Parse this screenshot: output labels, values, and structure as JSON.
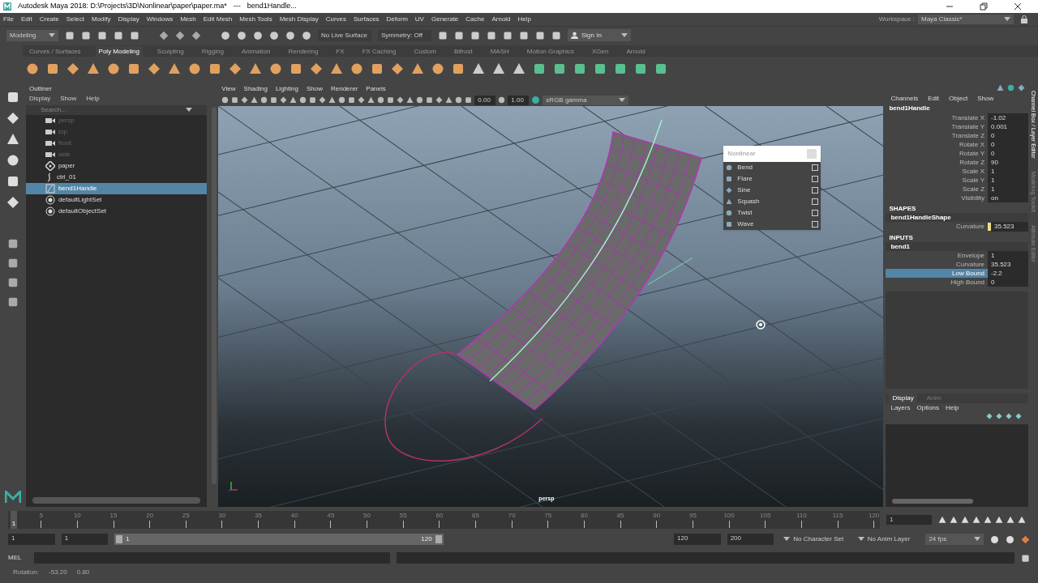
{
  "title_bar": {
    "app_title": "Autodesk Maya 2018: D:\\Projects\\3D\\Nonlinear\\paper\\paper.ma*",
    "separator": "---",
    "object": "bend1Handle..."
  },
  "menu_bar": {
    "items": [
      "File",
      "Edit",
      "Create",
      "Select",
      "Modify",
      "Display",
      "Windows",
      "Mesh",
      "Edit Mesh",
      "Mesh Tools",
      "Mesh Display",
      "Curves",
      "Surfaces",
      "Deform",
      "UV",
      "Generate",
      "Cache",
      "Arnold",
      "Help"
    ],
    "workspace_label": "Workspace :",
    "workspace": "Maya Classic*"
  },
  "status_line": {
    "menu_set": "Modeling",
    "live_surface": "No Live Surface",
    "symmetry": "Symmetry: Off",
    "sign_in": "Sign In"
  },
  "shelf": {
    "tabs": [
      {
        "label": "Curves / Surfaces",
        "selected": false
      },
      {
        "label": "Poly Modeling",
        "selected": true
      },
      {
        "label": "Sculpting",
        "selected": false
      },
      {
        "label": "Rigging",
        "selected": false
      },
      {
        "label": "Animation",
        "selected": false
      },
      {
        "label": "Rendering",
        "selected": false
      },
      {
        "label": "FX",
        "selected": false
      },
      {
        "label": "FX Caching",
        "selected": false
      },
      {
        "label": "Custom",
        "selected": false
      },
      {
        "label": "Bifrost",
        "selected": false
      },
      {
        "label": "MASH",
        "selected": false
      },
      {
        "label": "Motion Graphics",
        "selected": false
      },
      {
        "label": "XGen",
        "selected": false
      },
      {
        "label": "Arnold",
        "selected": false
      }
    ]
  },
  "outliner": {
    "title": "Outliner",
    "menus": [
      "Display",
      "Show",
      "Help"
    ],
    "search_placeholder": "Search...",
    "items": [
      {
        "label": "persp",
        "kind": "camera",
        "dimmed": true,
        "selected": false
      },
      {
        "label": "top",
        "kind": "camera",
        "dimmed": true,
        "selected": false
      },
      {
        "label": "front",
        "kind": "camera",
        "dimmed": true,
        "selected": false
      },
      {
        "label": "side",
        "kind": "camera",
        "dimmed": true,
        "selected": false
      },
      {
        "label": "paper",
        "kind": "transform",
        "dimmed": false,
        "selected": false
      },
      {
        "label": "ctrl_01",
        "kind": "curve",
        "dimmed": false,
        "selected": false
      },
      {
        "label": "bend1Handle",
        "kind": "deformer",
        "dimmed": false,
        "selected": true
      },
      {
        "label": "defaultLightSet",
        "kind": "set",
        "dimmed": false,
        "selected": false
      },
      {
        "label": "defaultObjectSet",
        "kind": "set",
        "dimmed": false,
        "selected": false
      }
    ]
  },
  "viewport": {
    "menus": [
      "View",
      "Shading",
      "Lighting",
      "Show",
      "Renderer",
      "Panels"
    ],
    "exposure": "0.00",
    "gamma": "1.00",
    "color_space": "sRGB gamma",
    "camera_label": "persp",
    "nonlinear_menu": {
      "title": "Nonlinear",
      "items": [
        "Bend",
        "Flare",
        "Sine",
        "Squash",
        "Twist",
        "Wave"
      ]
    }
  },
  "channel_box": {
    "menus": [
      "Channels",
      "Edit",
      "Object",
      "Show"
    ],
    "node": "bend1Handle",
    "attributes": [
      {
        "name": "Translate X",
        "value": "-1.02",
        "selected": false
      },
      {
        "name": "Translate Y",
        "value": "0.001",
        "selected": false
      },
      {
        "name": "Translate Z",
        "value": "0",
        "selected": false
      },
      {
        "name": "Rotate X",
        "value": "0",
        "selected": false
      },
      {
        "name": "Rotate Y",
        "value": "0",
        "selected": false
      },
      {
        "name": "Rotate Z",
        "value": "90",
        "selected": false
      },
      {
        "name": "Scale X",
        "value": "1",
        "selected": false
      },
      {
        "name": "Scale Y",
        "value": "1",
        "selected": false
      },
      {
        "name": "Scale Z",
        "value": "1",
        "selected": false
      },
      {
        "name": "Visibility",
        "value": "on",
        "selected": false
      }
    ],
    "shapes_header": "SHAPES",
    "shape_node": "bend1HandleShape",
    "shape_attributes": [
      {
        "name": "Curvature",
        "value": "35.523",
        "keyed": true
      }
    ],
    "inputs_header": "INPUTS",
    "input_node": "bend1",
    "input_attributes": [
      {
        "name": "Envelope",
        "value": "1",
        "selected": false
      },
      {
        "name": "Curvature",
        "value": "35.523",
        "selected": false
      },
      {
        "name": "Low Bound",
        "value": "-2.2",
        "selected": true
      },
      {
        "name": "High Bound",
        "value": "0",
        "selected": false
      }
    ]
  },
  "layer_editor": {
    "tabs": [
      {
        "label": "Display",
        "selected": true
      },
      {
        "label": "Anim",
        "selected": false
      }
    ],
    "menus": [
      "Layers",
      "Options",
      "Help"
    ]
  },
  "side_tabs": [
    "Channel Box / Layer Editor",
    "Modeling Toolkit",
    "Attribute Editor"
  ],
  "time_slider": {
    "ticks": [
      "5",
      "10",
      "15",
      "20",
      "25",
      "30",
      "35",
      "40",
      "45",
      "50",
      "55",
      "60",
      "65",
      "70",
      "75",
      "80",
      "85",
      "90",
      "95",
      "100",
      "105",
      "110",
      "115",
      "120"
    ],
    "current_frame": "1",
    "frame_field": "1",
    "level": 0
  },
  "range_slider": {
    "start": "1",
    "playback_start": "1",
    "range_start": "1",
    "range_end": "120",
    "playback_end": "120",
    "end": "200",
    "character_set": "No Character Set",
    "anim_layer": "No Anim Layer",
    "fps": "24 fps",
    "level": 1
  },
  "command_line": {
    "label": "MEL"
  },
  "help_line": {
    "label": "Rotation:",
    "values": [
      "-53.20",
      "0.80"
    ]
  }
}
